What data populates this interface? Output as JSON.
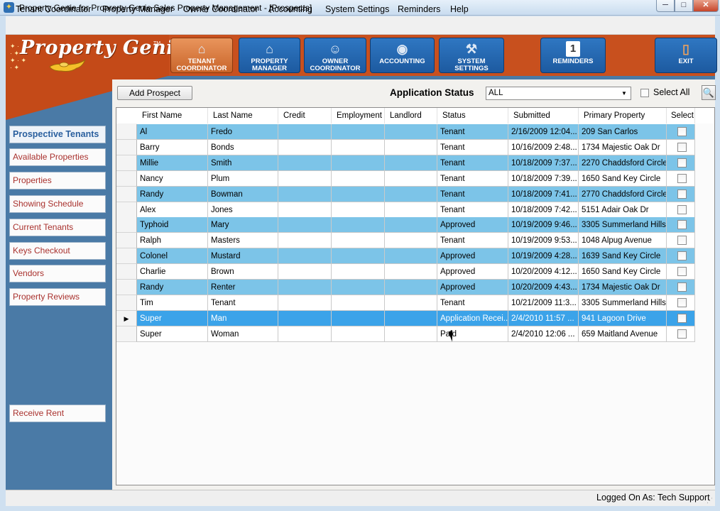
{
  "window": {
    "title": "Property Genie for Proprerty Genie Sales Property Management - [Prospects]",
    "minimize": "─",
    "maximize": "□",
    "close": "✕"
  },
  "menu": [
    "Tenant Coordinator",
    "Property Manager",
    "Owner Coordinator",
    "Accounting",
    "System Settings",
    "Reminders",
    "Help"
  ],
  "logo": {
    "text": "Property Genie",
    "tm": "TM"
  },
  "toolbar": [
    {
      "label": "TENANT COORDINATOR",
      "icon": "house-icon",
      "glyph": "⌂"
    },
    {
      "label": "PROPERTY MANAGER",
      "icon": "house-icon",
      "glyph": "⌂"
    },
    {
      "label": "OWNER COORDINATOR",
      "icon": "owner-icon",
      "glyph": "☺"
    },
    {
      "label": "ACCOUNTING",
      "icon": "money-house-icon",
      "glyph": "◉"
    },
    {
      "label": "SYSTEM SETTINGS",
      "icon": "tools-icon",
      "glyph": "⚒"
    },
    {
      "label": "REMINDERS",
      "icon": "calendar-icon",
      "glyph": "1"
    },
    {
      "label": "EXIT",
      "icon": "door-icon",
      "glyph": "▯"
    }
  ],
  "sidebar": {
    "items": [
      "Prospective Tenants",
      "Available Properties",
      "Properties",
      "Showing Schedule",
      "Current Tenants",
      "Keys Checkout",
      "Vendors",
      "Property Reviews"
    ],
    "receive_rent": "Receive Rent"
  },
  "filters": {
    "add_prospect": "Add Prospect",
    "status_label": "Application Status",
    "status_value": "ALL",
    "select_all": "Select All",
    "search_icon": "search-icon"
  },
  "grid": {
    "columns": [
      "First Name",
      "Last Name",
      "Credit",
      "Employment",
      "Landlord",
      "Status",
      "Submitted",
      "Primary Property",
      "Select"
    ],
    "rows": [
      [
        "Al",
        "Fredo",
        "",
        "",
        "",
        "Tenant",
        "2/16/2009 12:04...",
        "209 San Carlos"
      ],
      [
        "Barry",
        "Bonds",
        "",
        "",
        "",
        "Tenant",
        "10/16/2009 2:48...",
        "1734 Majestic Oak Dr"
      ],
      [
        "Millie",
        "Smith",
        "",
        "",
        "",
        "Tenant",
        "10/18/2009 7:37...",
        "2270 Chaddsford Circle"
      ],
      [
        "Nancy",
        "Plum",
        "",
        "",
        "",
        "Tenant",
        "10/18/2009 7:39...",
        "1650 Sand Key Circle"
      ],
      [
        "Randy",
        "Bowman",
        "",
        "",
        "",
        "Tenant",
        "10/18/2009 7:41...",
        "2770 Chaddsford Circle"
      ],
      [
        "Alex",
        "Jones",
        "",
        "",
        "",
        "Tenant",
        "10/18/2009 7:42...",
        "5151 Adair Oak Dr"
      ],
      [
        "Typhoid",
        "Mary",
        "",
        "",
        "",
        "Approved",
        "10/19/2009 9:46...",
        "3305 Summerland Hills..."
      ],
      [
        "Ralph",
        "Masters",
        "",
        "",
        "",
        "Tenant",
        "10/19/2009 9:53...",
        "1048 Alpug Avenue"
      ],
      [
        "Colonel",
        "Mustard",
        "",
        "",
        "",
        "Approved",
        "10/19/2009 4:28...",
        "1639 Sand Key Circle"
      ],
      [
        "Charlie",
        "Brown",
        "",
        "",
        "",
        "Approved",
        "10/20/2009 4:12...",
        "1650 Sand Key Circle"
      ],
      [
        "Randy",
        "Renter",
        "",
        "",
        "",
        "Approved",
        "10/20/2009 4:43...",
        "1734 Majestic Oak Dr"
      ],
      [
        "Tim",
        "Tenant",
        "",
        "",
        "",
        "Tenant",
        "10/21/2009 11:3...",
        "3305 Summerland Hills..."
      ],
      [
        "Super",
        "Man",
        "",
        "",
        "",
        "Application Recei...",
        "2/4/2010 11:57 ...",
        "941 Lagoon Drive"
      ],
      [
        "Super",
        "Woman",
        "",
        "",
        "",
        "Paid",
        "2/4/2010 12:06 ...",
        "659 Maitland Avenue"
      ]
    ],
    "selected_row": 12,
    "row_pointer": "▶"
  },
  "statusbar": {
    "logged_on": "Logged On As: Tech Support"
  }
}
